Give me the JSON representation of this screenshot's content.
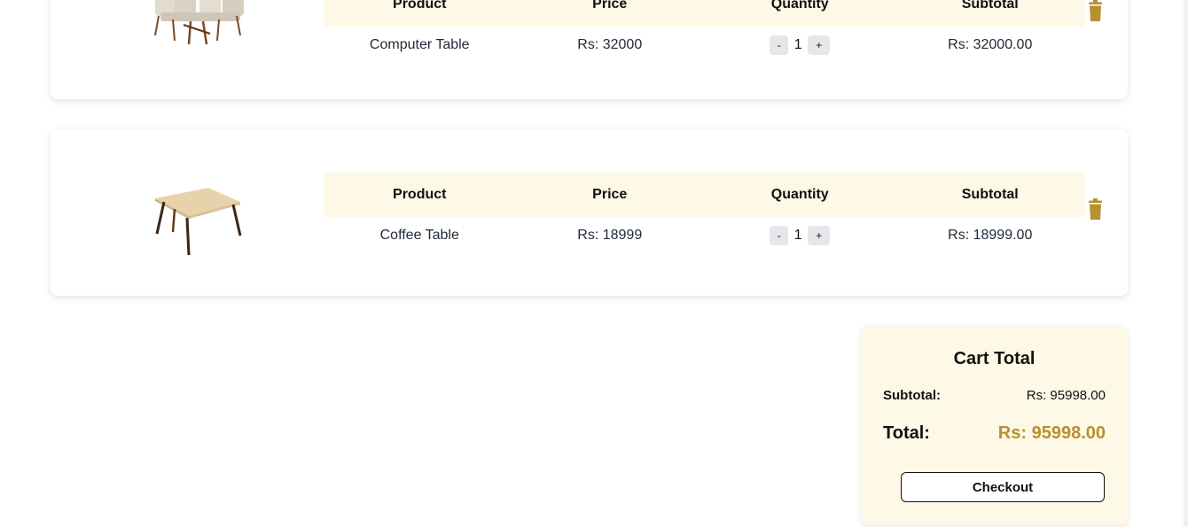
{
  "cart_items": [
    {
      "headers": {
        "product": "Product",
        "price": "Price",
        "quantity": "Quantity",
        "subtotal": "Subtotal"
      },
      "name": "Computer Table",
      "price": "Rs: 32000",
      "quantity": "1",
      "subtotal": "Rs: 32000.00",
      "qty_minus": "-",
      "qty_plus": "+"
    },
    {
      "headers": {
        "product": "Product",
        "price": "Price",
        "quantity": "Quantity",
        "subtotal": "Subtotal"
      },
      "name": "Coffee Table",
      "price": "Rs: 18999",
      "quantity": "1",
      "subtotal": "Rs: 18999.00",
      "qty_minus": "-",
      "qty_plus": "+"
    }
  ],
  "cart_total": {
    "title": "Cart Total",
    "subtotal_label": "Subtotal:",
    "subtotal_value": "Rs: 95998.00",
    "total_label": "Total:",
    "total_value": "Rs: 95998.00",
    "checkout_label": "Checkout"
  },
  "icons": {
    "delete": "trash-icon"
  },
  "colors": {
    "accent": "#b8902f",
    "header_bg": "#fef8e6",
    "qty_button_bg": "#e5e7eb"
  }
}
